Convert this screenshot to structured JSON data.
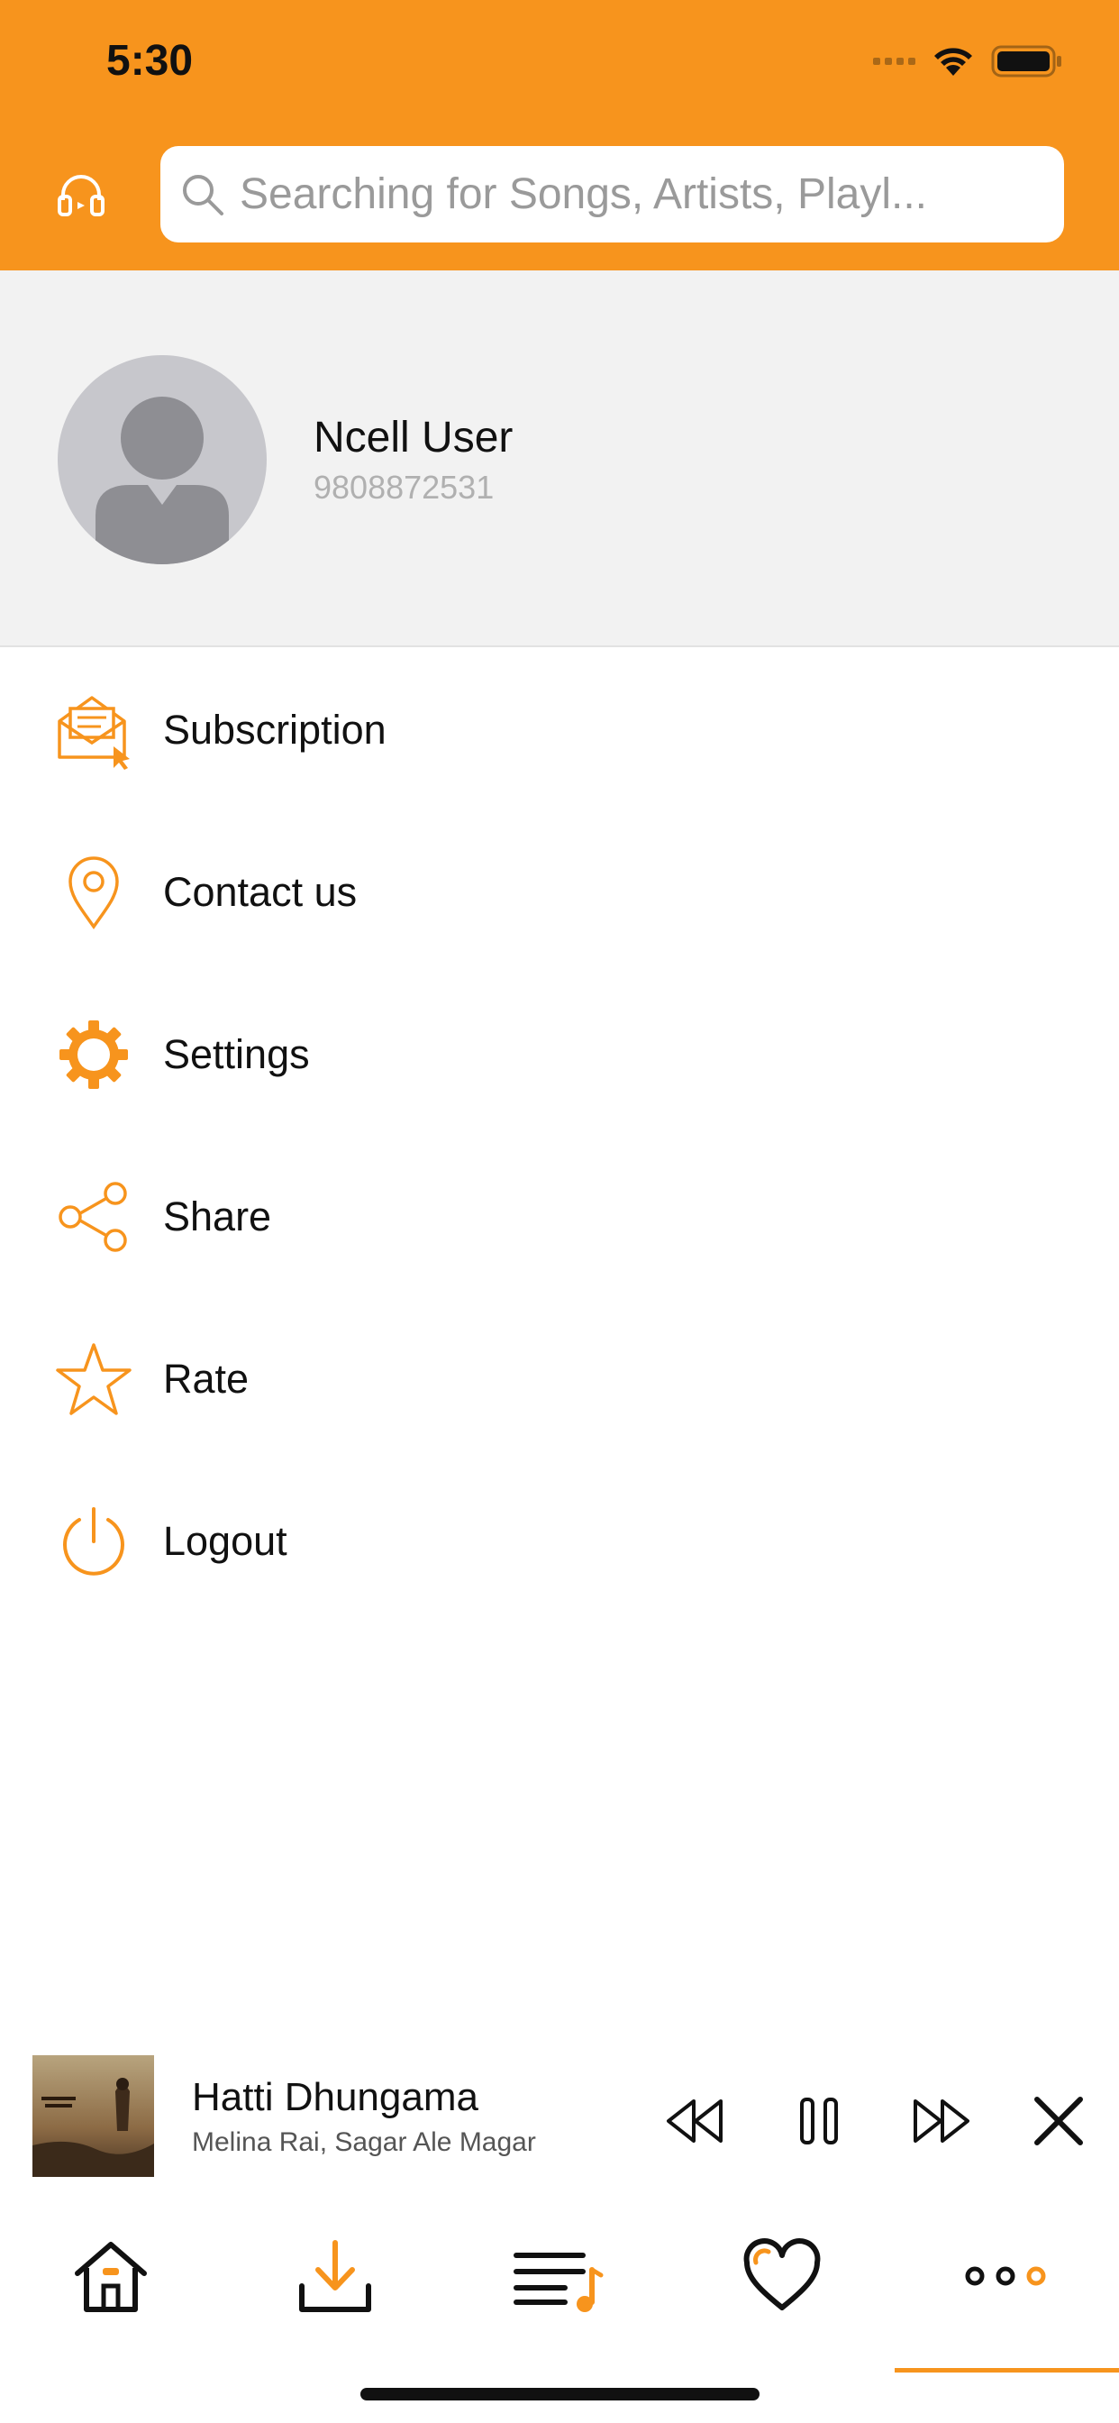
{
  "status_bar": {
    "time": "5:30"
  },
  "header": {
    "icon": "headphones-icon",
    "search": {
      "placeholder": "Searching for Songs, Artists, Playl...",
      "value": ""
    },
    "accent_color": "#F7941D"
  },
  "profile": {
    "name": "Ncell User",
    "phone": "9808872531"
  },
  "menu": {
    "items": [
      {
        "label": "Subscription",
        "icon": "envelope-subscription-icon"
      },
      {
        "label": "Contact us",
        "icon": "location-pin-icon"
      },
      {
        "label": "Settings",
        "icon": "gear-icon"
      },
      {
        "label": "Share",
        "icon": "share-icon"
      },
      {
        "label": "Rate",
        "icon": "star-icon"
      },
      {
        "label": "Logout",
        "icon": "power-icon"
      }
    ]
  },
  "player": {
    "title": "Hatti Dhungama",
    "artist": "Melina Rai, Sagar Ale Magar",
    "controls": [
      "rewind-icon",
      "pause-icon",
      "fast-forward-icon",
      "close-icon"
    ]
  },
  "tabbar": {
    "tabs": [
      {
        "icon": "home-icon"
      },
      {
        "icon": "download-icon"
      },
      {
        "icon": "playlist-icon"
      },
      {
        "icon": "heart-icon"
      },
      {
        "icon": "more-icon",
        "active": true
      }
    ]
  }
}
